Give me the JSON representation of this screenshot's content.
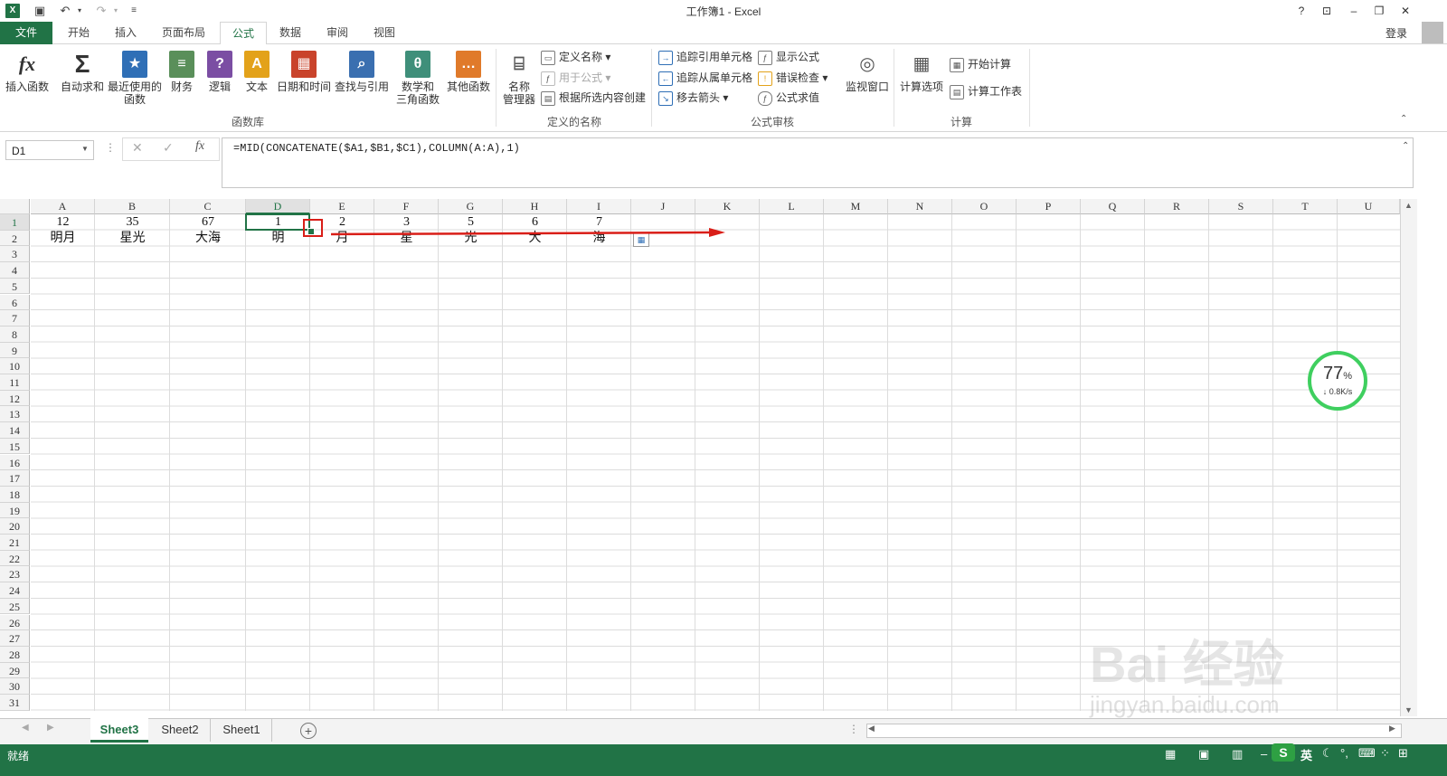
{
  "app": {
    "title": "工作簿1 - Excel",
    "logo_text": "X",
    "login": "登录"
  },
  "tabs": [
    "文件",
    "开始",
    "插入",
    "页面布局",
    "公式",
    "数据",
    "审阅",
    "视图"
  ],
  "ribbon": {
    "function_library": {
      "label": "函数库",
      "buttons": [
        "插入函数",
        "自动求和",
        "最近使用的\n函数",
        "财务",
        "逻辑",
        "文本",
        "日期和时间",
        "查找与引用",
        "数学和\n三角函数",
        "其他函数"
      ]
    },
    "defined_names": {
      "label": "定义的名称",
      "name_manager": "名称\n管理器",
      "items": [
        "定义名称",
        "用于公式",
        "根据所选内容创建"
      ]
    },
    "formula_auditing": {
      "label": "公式审核",
      "items": [
        "追踪引用单元格",
        "追踪从属单元格",
        "移去箭头",
        "显示公式",
        "错误检查",
        "公式求值"
      ],
      "watch_window": "监视窗口"
    },
    "calculation": {
      "label": "计算",
      "options": "计算选项",
      "items": [
        "开始计算",
        "计算工作表"
      ]
    }
  },
  "formula_bar": {
    "name_box": "D1",
    "formula": "=MID(CONCATENATE($A1,$B1,$C1),COLUMN(A:A),1)",
    "fx": "fx"
  },
  "columns": [
    "A",
    "B",
    "C",
    "D",
    "E",
    "F",
    "G",
    "H",
    "I",
    "J",
    "K",
    "L",
    "M",
    "N",
    "O",
    "P",
    "Q",
    "R",
    "S",
    "T",
    "U"
  ],
  "rows": [
    "1",
    "2",
    "3",
    "4",
    "5",
    "6",
    "7",
    "8",
    "9",
    "10",
    "11",
    "12",
    "13",
    "14",
    "15",
    "16",
    "17",
    "18",
    "19",
    "20",
    "21",
    "22",
    "23",
    "24",
    "25",
    "26",
    "27",
    "28",
    "29",
    "30",
    "31"
  ],
  "cells": {
    "row1": [
      "12",
      "35",
      "67",
      "1",
      "2",
      "3",
      "5",
      "6",
      "7"
    ],
    "row2": [
      "明月",
      "星光",
      "大海",
      "明",
      "月",
      "星",
      "光",
      "大",
      "海"
    ]
  },
  "net_widget": {
    "percent": "77",
    "unit": "%",
    "speed": "0.8K/s"
  },
  "sheets": [
    "Sheet3",
    "Sheet2",
    "Sheet1"
  ],
  "status": {
    "ready": "就绪"
  },
  "ime": {
    "lang": "英"
  },
  "watermark": {
    "brand": "Bai 经验",
    "url": "jingyan.baidu.com"
  },
  "colors": {
    "excel_green": "#217346",
    "annotation_red": "#d91e18"
  }
}
